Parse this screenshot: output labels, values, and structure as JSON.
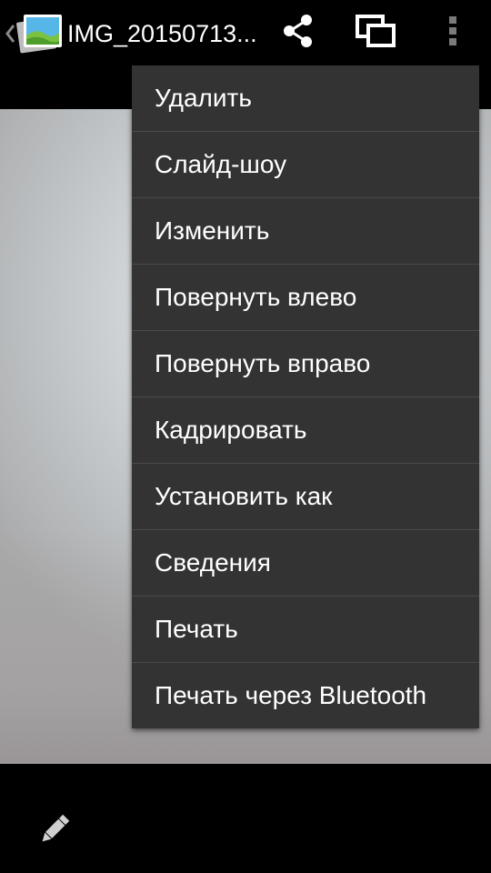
{
  "action_bar": {
    "title": "IMG_20150713...",
    "icons": {
      "up": "chevron-left-icon",
      "app": "gallery-photo-icon",
      "share": "share-icon",
      "compare": "filmstrip-icon",
      "overflow": "more-vert-icon"
    }
  },
  "menu": {
    "items": [
      {
        "label": "Удалить"
      },
      {
        "label": "Слайд-шоу"
      },
      {
        "label": "Изменить"
      },
      {
        "label": "Повернуть влево"
      },
      {
        "label": "Повернуть вправо"
      },
      {
        "label": "Кадрировать"
      },
      {
        "label": "Установить как"
      },
      {
        "label": "Сведения"
      },
      {
        "label": "Печать"
      },
      {
        "label": "Печать через Bluetooth"
      }
    ]
  },
  "bottom_bar": {
    "icons": {
      "edit": "pencil-icon"
    }
  },
  "colors": {
    "menu_bg": "#333333",
    "divider": "#4a4a4a",
    "bar_bg": "#000000",
    "text": "#ffffff"
  }
}
